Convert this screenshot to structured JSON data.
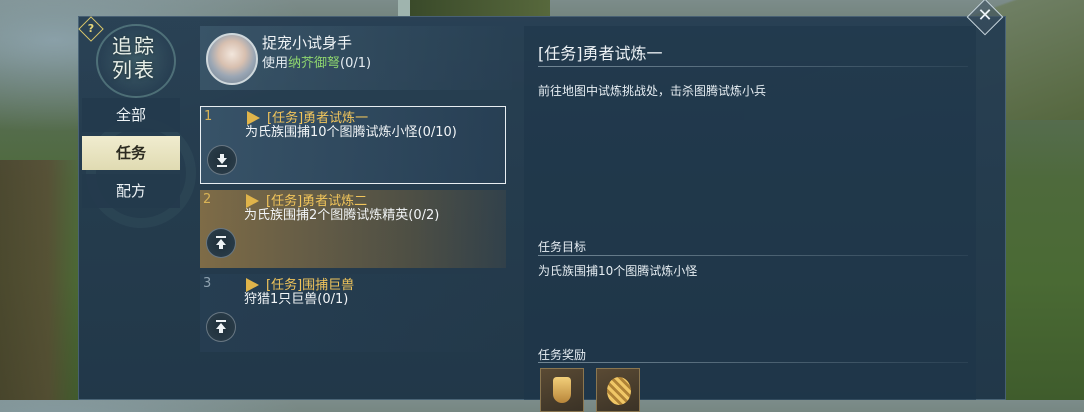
{
  "emblem": {
    "title": "追踪列表"
  },
  "help": {
    "label": "?"
  },
  "close": {
    "label": "✕"
  },
  "tabs": [
    {
      "label": "全部",
      "active": false
    },
    {
      "label": "任务",
      "active": true
    },
    {
      "label": "配方",
      "active": false
    }
  ],
  "tracked": {
    "title": "捉宠小试身手",
    "sub_prefix": "使用",
    "sub_item": "纳芥御弩",
    "sub_count": "(0/1)"
  },
  "quests": [
    {
      "num": "1",
      "name": "[任务]勇者试炼一",
      "desc": "为氏族围捕10个图腾试炼小怪(0/10)",
      "arrow": "down"
    },
    {
      "num": "2",
      "name": "[任务]勇者试炼二",
      "desc": "为氏族围捕2个图腾试炼精英(0/2)",
      "arrow": "up"
    },
    {
      "num": "3",
      "name": "[任务]围捕巨兽",
      "desc": "狩猎1只巨兽(0/1)",
      "arrow": "up"
    }
  ],
  "detail": {
    "title": "[任务]勇者试炼一",
    "description": "前往地图中试炼挑战处，击杀图腾试炼小兵",
    "goal_head": "任务目标",
    "goal_text": "为氏族围捕10个图腾试炼小怪",
    "reward_head": "任务奖励",
    "rewards": [
      "bell-icon",
      "shield-icon"
    ]
  },
  "colors": {
    "accent_gold": "#f1c55b",
    "highlight_green": "#8fd66f",
    "panel": "#26405a"
  }
}
